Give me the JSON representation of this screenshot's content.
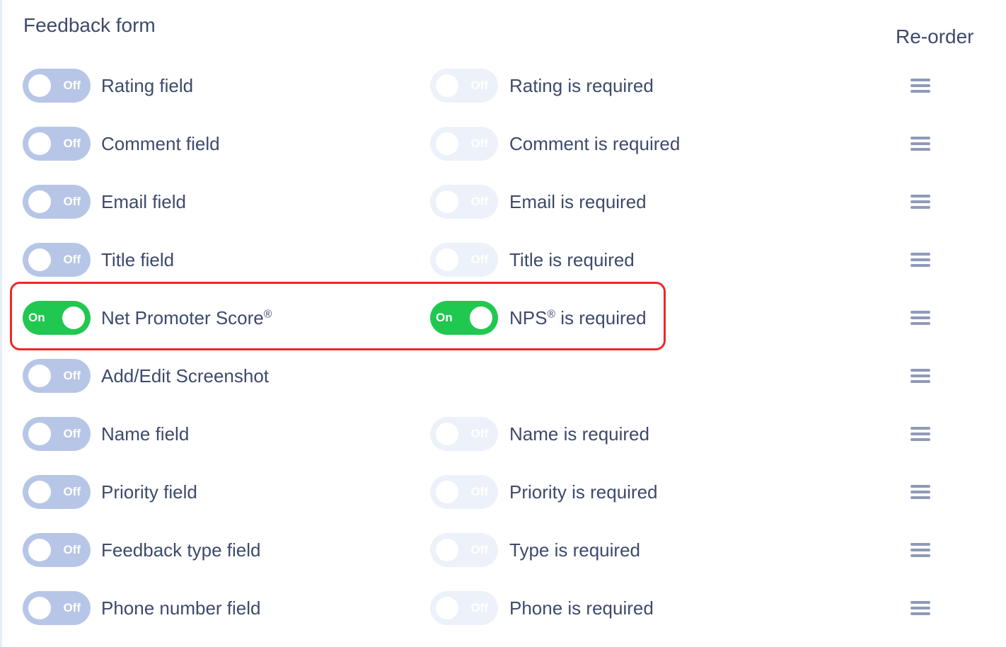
{
  "header": {
    "title": "Feedback form",
    "reorder_label": "Re-order"
  },
  "toggle_labels": {
    "on": "On",
    "off": "Off"
  },
  "colors": {
    "toggle_on": "#21c84f",
    "toggle_off": "#b7c6e7",
    "toggle_disabled": "#edf1f9",
    "highlight_border": "#f0262b",
    "text": "#3d4a6b"
  },
  "rows": [
    {
      "field_label": "Rating field",
      "field_state": "Off",
      "required_label": "Rating is required",
      "required_state": "Off",
      "required_disabled": true
    },
    {
      "field_label": "Comment field",
      "field_state": "Off",
      "required_label": "Comment is required",
      "required_state": "Off",
      "required_disabled": true
    },
    {
      "field_label": "Email field",
      "field_state": "Off",
      "required_label": "Email is required",
      "required_state": "Off",
      "required_disabled": true
    },
    {
      "field_label": "Title field",
      "field_state": "Off",
      "required_label": "Title is required",
      "required_state": "Off",
      "required_disabled": true
    },
    {
      "field_label": "Net Promoter Score®",
      "field_state": "On",
      "required_label": "NPS® is required",
      "required_state": "On",
      "required_disabled": false,
      "highlighted": true
    },
    {
      "field_label": "Add/Edit Screenshot",
      "field_state": "Off",
      "required_label": null,
      "required_state": null
    },
    {
      "field_label": "Name field",
      "field_state": "Off",
      "required_label": "Name is required",
      "required_state": "Off",
      "required_disabled": true
    },
    {
      "field_label": "Priority field",
      "field_state": "Off",
      "required_label": "Priority is required",
      "required_state": "Off",
      "required_disabled": true
    },
    {
      "field_label": "Feedback type field",
      "field_state": "Off",
      "required_label": "Type is required",
      "required_state": "Off",
      "required_disabled": true
    },
    {
      "field_label": "Phone number field",
      "field_state": "Off",
      "required_label": "Phone is required",
      "required_state": "Off",
      "required_disabled": true
    }
  ]
}
